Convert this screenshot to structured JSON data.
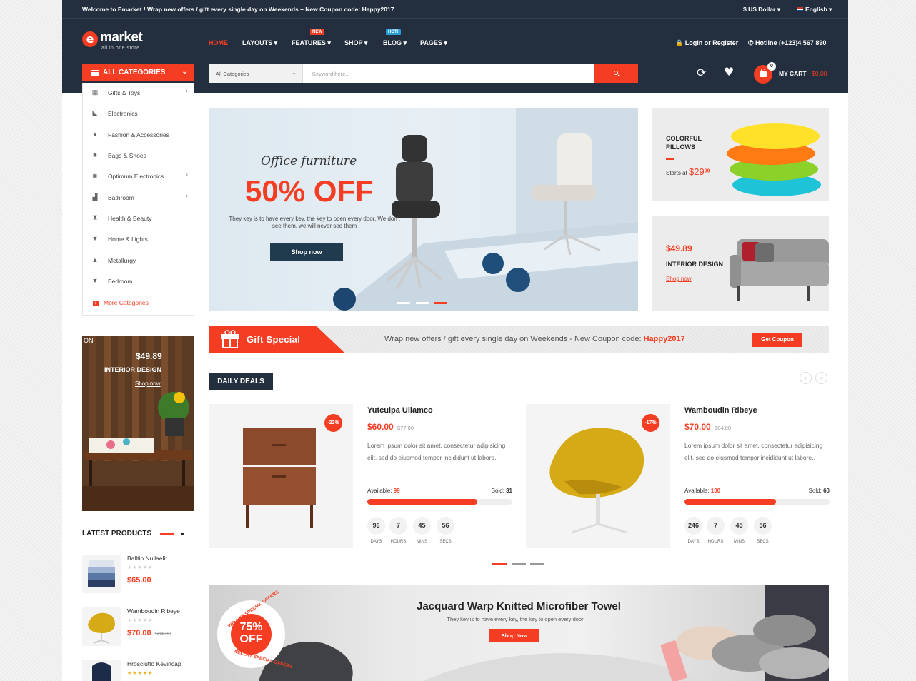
{
  "topbar": {
    "welcome": "Welcome to Emarket ! Wrap new offers / gift every single day on Weekends – New Coupon code: Happy2017",
    "currency": "$ US Dollar ▾",
    "language": "English ▾"
  },
  "logo": {
    "letter": "e",
    "name": "market",
    "tagline": "all in one store"
  },
  "nav": {
    "items": [
      {
        "label": "HOME"
      },
      {
        "label": "LAYOUTS ▾"
      },
      {
        "label": "FEATURES ▾",
        "badge": "NEW"
      },
      {
        "label": "SHOP ▾"
      },
      {
        "label": "BLOG ▾",
        "badge": "HOT!"
      },
      {
        "label": "PAGES ▾"
      }
    ]
  },
  "account": {
    "login": "🔒 Login or Register",
    "hotline": "✆ Hotline (+123)4 567 890"
  },
  "categories_button": {
    "label": "ALL CATEGORIES",
    "chevron": "⌄"
  },
  "search": {
    "category": "All Categories",
    "placeholder": "Keyword here..."
  },
  "cart": {
    "count": "0",
    "label": "MY CART",
    "total": "- $0.00"
  },
  "sidebar": {
    "categories": [
      {
        "label": "Gifts & Toys",
        "icon": "gift-icon",
        "arrow": true
      },
      {
        "label": "Electronics",
        "icon": "drill-icon",
        "arrow": false
      },
      {
        "label": "Fashion & Accessories",
        "icon": "dress-icon",
        "arrow": false
      },
      {
        "label": "Bags & Shoes",
        "icon": "bag-icon",
        "arrow": false
      },
      {
        "label": "Optimum Electronics",
        "icon": "camera-icon",
        "arrow": true
      },
      {
        "label": "Bathroom",
        "icon": "bathroom-icon",
        "arrow": true
      },
      {
        "label": "Health & Beauty",
        "icon": "beauty-icon",
        "arrow": false
      },
      {
        "label": "Home & Lights",
        "icon": "lamp-icon",
        "arrow": false
      },
      {
        "label": "Metallurgy",
        "icon": "flask-icon",
        "arrow": false
      },
      {
        "label": "Bedroom",
        "icon": "bed-lamp-icon",
        "arrow": false
      }
    ],
    "more": "More Categories"
  },
  "hero": {
    "subtitle": "Office furniture",
    "headline": "50% OFF",
    "text": "They key is to have every key, the key to open every door. We don't see them, we will never see them",
    "button": "Shop now"
  },
  "banner_pillows": {
    "title_line1": "COLORFUL",
    "title_line2": "PILLOWS",
    "starts": "Starts at",
    "price": "$29",
    "cents": "99"
  },
  "banner_interior": {
    "price": "$49.89",
    "title": "INTERIOR DESIGN",
    "link": "Shop now"
  },
  "gift": {
    "title": "Gift Special",
    "message": "Wrap new offers / gift every single day on Weekends - New Coupon code:",
    "code": "Happy2017",
    "button": "Get Coupon"
  },
  "daily_deals": {
    "title": "DAILY DEALS",
    "items": [
      {
        "name": "Yutculpa Ullamco",
        "price": "$60.00",
        "old_price": "$77.00",
        "discount": "-22%",
        "desc": "Lorem ipsum dolor sit amet, consectetur adipisicing elit, sed do eiusmod tempor incididunt ut labore..",
        "available_label": "Available:",
        "available": "99",
        "sold_label": "Sold:",
        "sold": "31",
        "progress": 0.76,
        "countdown": [
          {
            "value": "96",
            "unit": "DAYS"
          },
          {
            "value": "7",
            "unit": "HOURS"
          },
          {
            "value": "45",
            "unit": "MINS"
          },
          {
            "value": "56",
            "unit": "SECS"
          }
        ]
      },
      {
        "name": "Wamboudin Ribeye",
        "price": "$70.00",
        "old_price": "$84.00",
        "discount": "-17%",
        "desc": "Lorem ipsum dolor sit amet, consectetur adipisicing elit, sed do eiusmod tempor incididunt ut labore..",
        "available_label": "Available:",
        "available": "100",
        "sold_label": "Sold:",
        "sold": "60",
        "progress": 0.63,
        "countdown": [
          {
            "value": "246",
            "unit": "DAYS"
          },
          {
            "value": "7",
            "unit": "HOURS"
          },
          {
            "value": "45",
            "unit": "MINS"
          },
          {
            "value": "56",
            "unit": "SECS"
          }
        ]
      }
    ]
  },
  "side_banner": {
    "price": "$49.89",
    "title": "INTERIOR DESIGN",
    "link": "Shop now",
    "corner": "ON"
  },
  "latest": {
    "title": "LATEST PRODUCTS",
    "items": [
      {
        "name": "Balltip Nullaelit",
        "stars": "★★★★★",
        "price": "$65.00",
        "old_price": ""
      },
      {
        "name": "Wamboudin Ribeye",
        "stars": "★★★★★",
        "price": "$70.00",
        "old_price": "$84.00"
      },
      {
        "name": "Hrosciutto Kevincap",
        "stars": "★★★★★",
        "price": "",
        "old_price": ""
      }
    ]
  },
  "towel": {
    "title": "Jacquard Warp Knitted Microfiber Towel",
    "subtitle": "They key is to have every key, the key to open every door",
    "button": "Shop Now",
    "stamp_percent": "75%",
    "stamp_off": "OFF",
    "stamp_ring": "WELLKY SPECIAL OFFERS"
  },
  "colors": {
    "accent": "#f43d22",
    "header": "#232f3e"
  }
}
